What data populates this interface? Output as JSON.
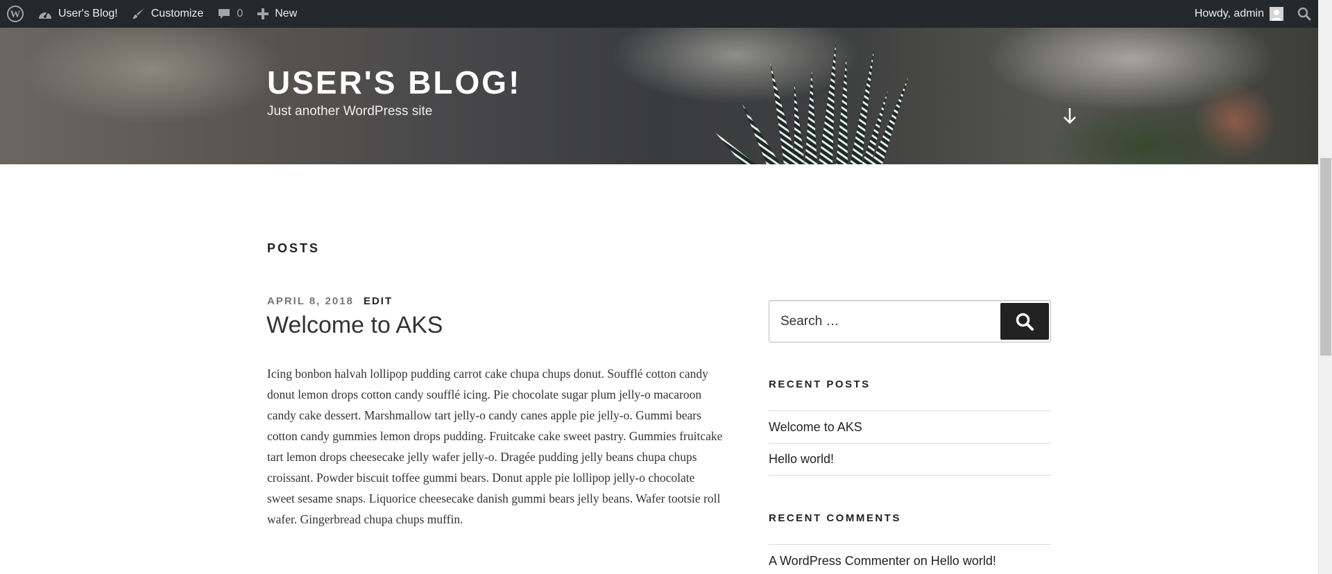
{
  "adminbar": {
    "site_name": "User's Blog!",
    "customize": "Customize",
    "comments_count": "0",
    "new_label": "New",
    "howdy": "Howdy, admin"
  },
  "header": {
    "title": "USER'S BLOG!",
    "description": "Just another WordPress site"
  },
  "main": {
    "page_title": "POSTS",
    "post": {
      "date": "APRIL 8, 2018",
      "edit": "EDIT",
      "title": "Welcome to AKS",
      "content": "Icing bonbon halvah lollipop pudding carrot cake chupa chups donut. Soufflé cotton candy donut lemon drops cotton candy soufflé icing. Pie chocolate sugar plum jelly-o macaroon candy cake dessert. Marshmallow tart jelly-o candy canes apple pie jelly-o. Gummi bears cotton candy gummies lemon drops pudding. Fruitcake cake sweet pastry. Gummies fruitcake tart lemon drops cheesecake jelly wafer jelly-o. Dragée pudding jelly beans chupa chups croissant. Powder biscuit toffee gummi bears. Donut apple pie lollipop jelly-o chocolate sweet sesame snaps. Liquorice cheesecake danish gummi bears jelly beans. Wafer tootsie roll wafer. Gingerbread chupa chups muffin."
    }
  },
  "sidebar": {
    "search_placeholder": "Search …",
    "recent_posts_title": "RECENT POSTS",
    "recent_posts": [
      "Welcome to AKS",
      "Hello world!"
    ],
    "recent_comments_title": "RECENT COMMENTS",
    "recent_comment": {
      "author": "A WordPress Commenter",
      "on": "on",
      "post": "Hello world!"
    }
  },
  "colors": {
    "adminbar_bg": "#23282d",
    "text": "#222222",
    "meta_gray": "#767676"
  }
}
